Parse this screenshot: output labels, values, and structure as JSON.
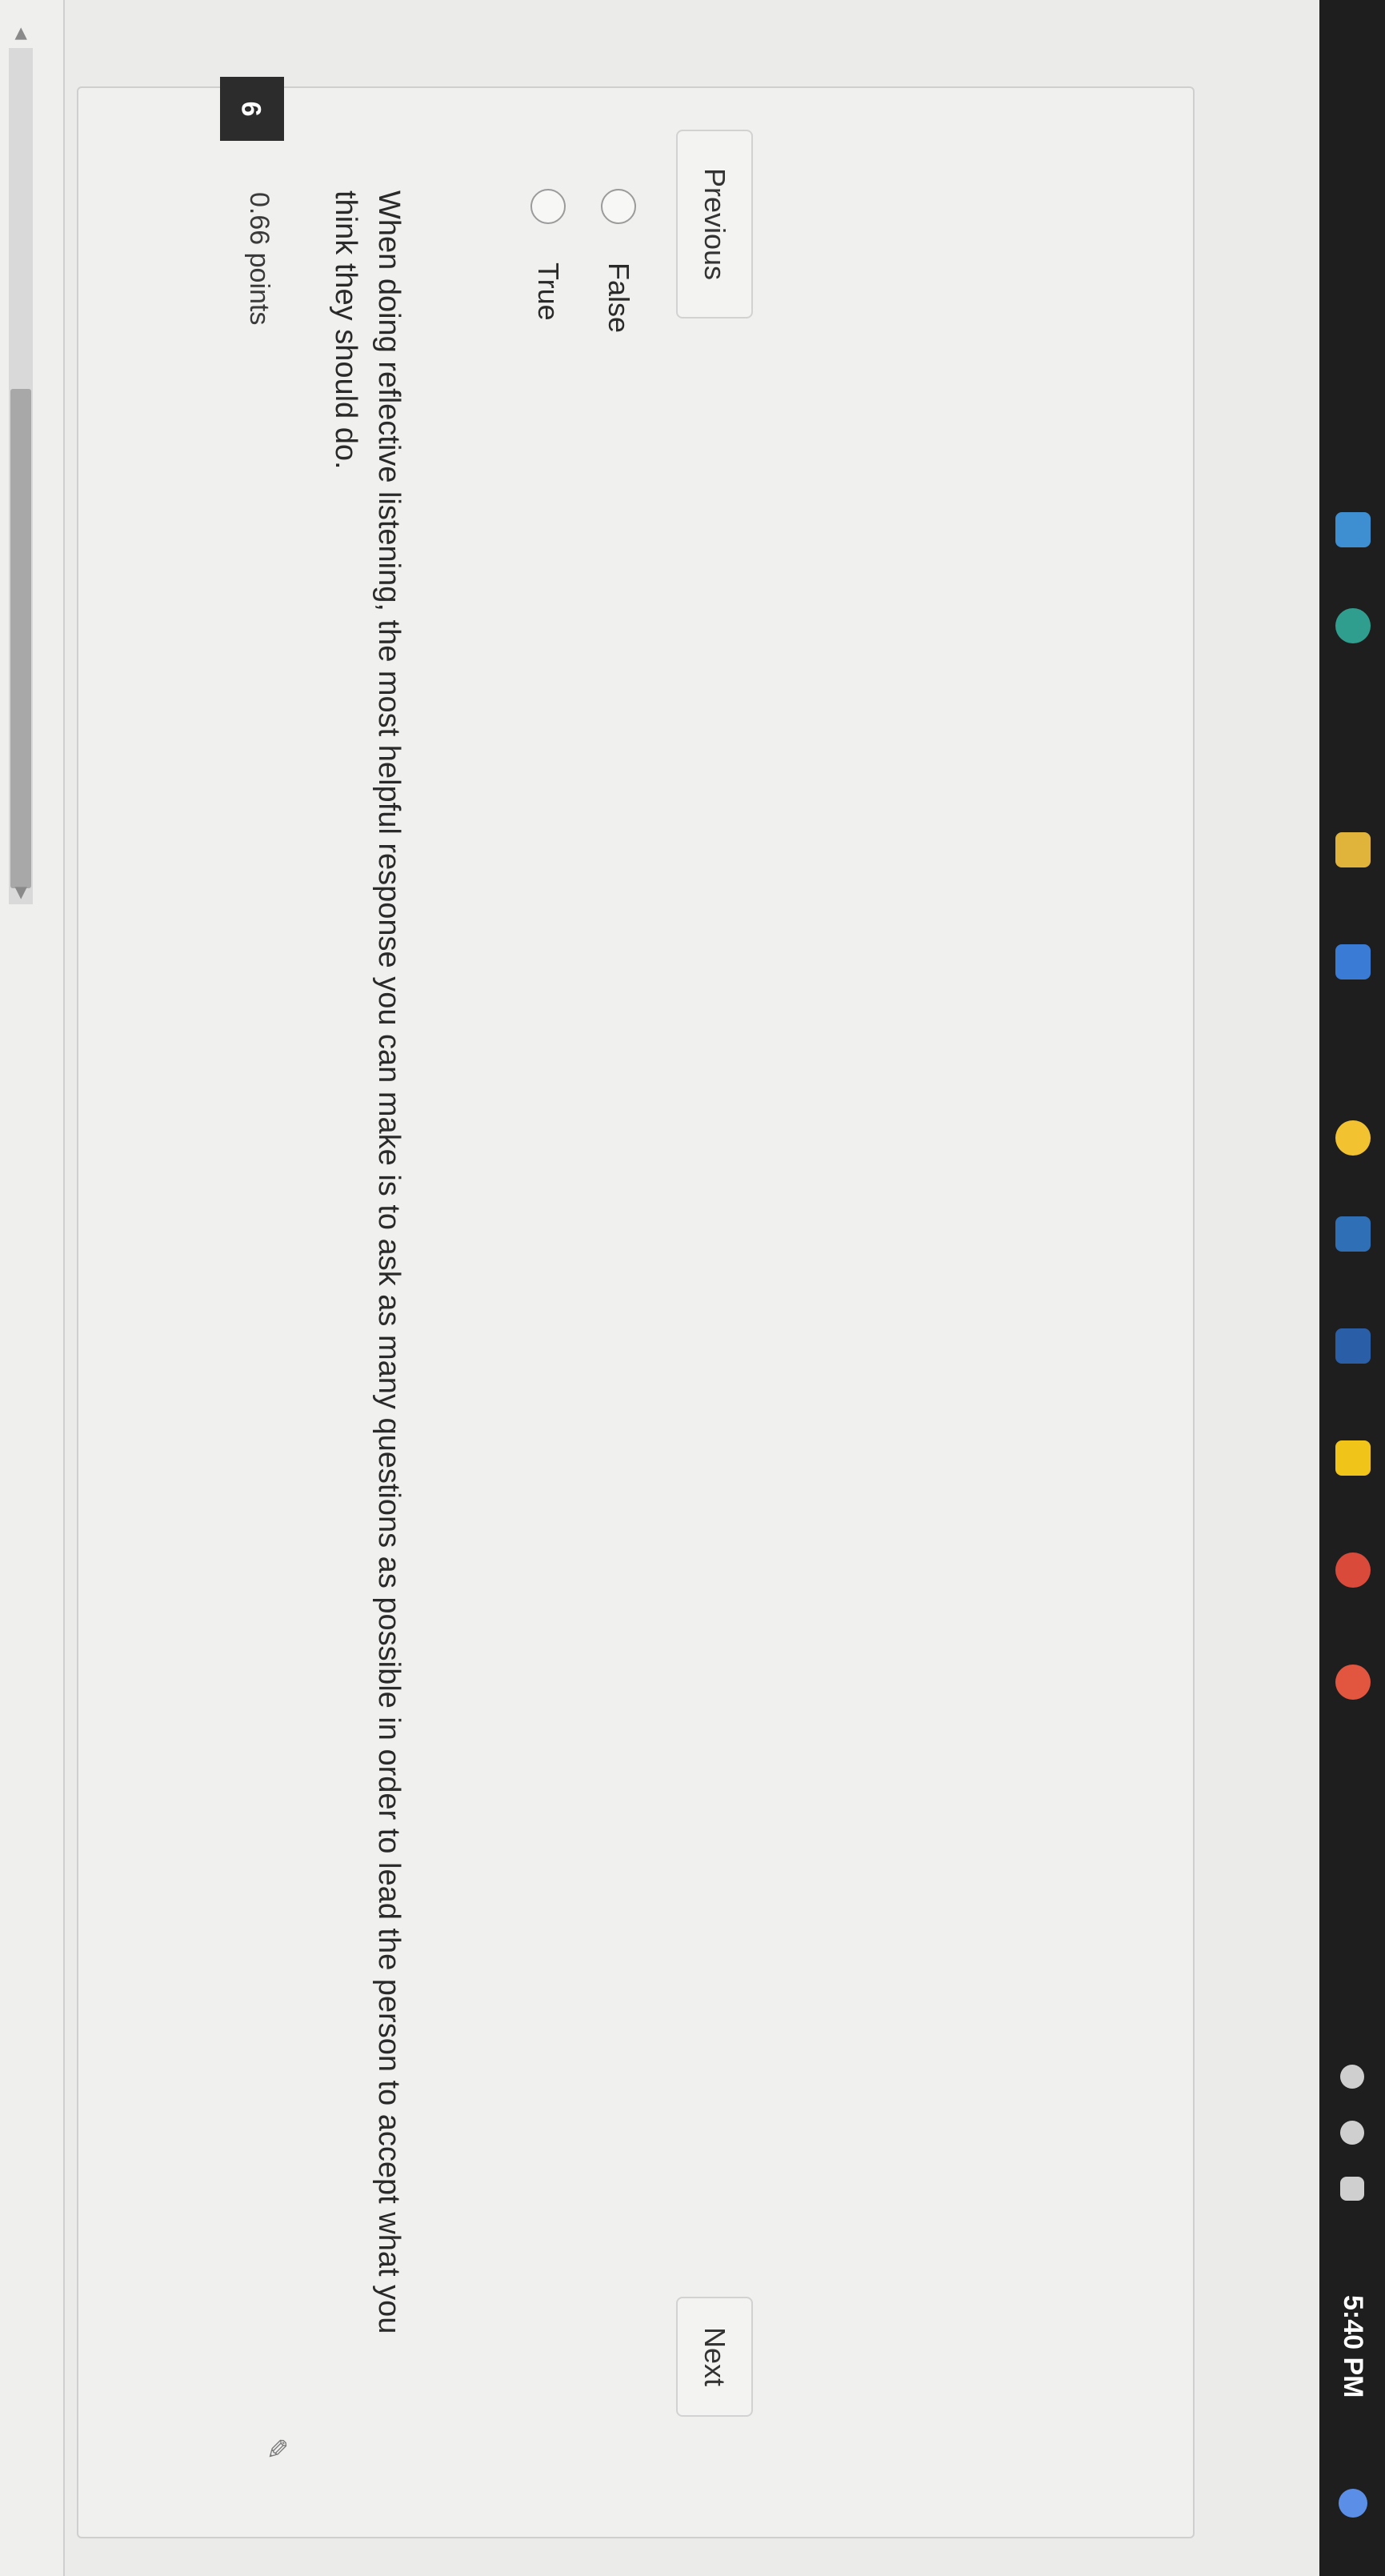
{
  "question": {
    "number": "9",
    "points": "0.66 points",
    "text": "When doing reflective listening, the most helpful response you can make is to ask as many questions as possible in order to lead the person to accept what you think they should do.",
    "options": [
      {
        "label": "True",
        "selected": false
      },
      {
        "label": "False",
        "selected": false
      }
    ]
  },
  "navigation": {
    "previous_label": "Previous",
    "next_label": "Next"
  },
  "taskbar": {
    "clock": "5:40 PM"
  },
  "icons": {
    "pin": "pin-icon",
    "scroll_left": "scroll-left-arrow-icon",
    "scroll_right": "scroll-right-arrow-icon"
  }
}
